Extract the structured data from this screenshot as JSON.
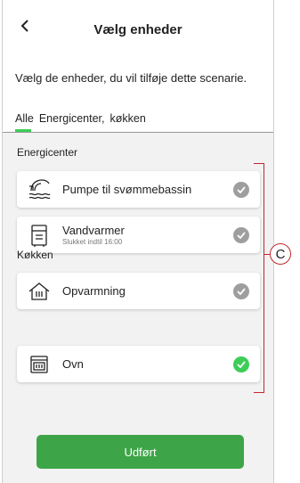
{
  "header": {
    "title": "Vælg enheder"
  },
  "subtitle": "Vælg de enheder, du vil tilføje dette scenarie.",
  "tabs": [
    {
      "label": "Alle"
    },
    {
      "label": "Energicenter,"
    },
    {
      "label": "køkken"
    }
  ],
  "sections": [
    {
      "label": "Energicenter",
      "devices": [
        {
          "name": "Pumpe til svømmebassin",
          "status": "",
          "icon": "pool-pump-icon",
          "selected": false
        },
        {
          "name": "Vandvarmer",
          "status": "Slukket indtil 16:00",
          "icon": "water-heater-icon",
          "selected": false
        }
      ]
    },
    {
      "label": "Køkken",
      "devices": [
        {
          "name": "Opvarmning",
          "status": "",
          "icon": "heating-icon",
          "selected": false
        },
        {
          "name": "Ovn",
          "status": "",
          "icon": "oven-icon",
          "selected": true
        }
      ]
    }
  ],
  "done_button": {
    "label": "Udført"
  },
  "callout": {
    "label": "C"
  },
  "colors": {
    "accent": "#3dcd58",
    "button": "#3da547",
    "unchecked": "#9e9e9e",
    "callout": "#c2272d"
  }
}
